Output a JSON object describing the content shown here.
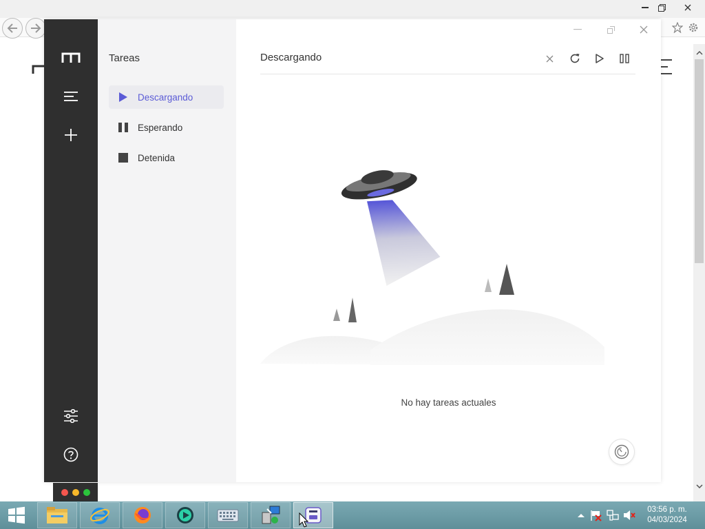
{
  "app": {
    "nav_title": "Tareas",
    "nav_items": [
      {
        "label": "Descargando",
        "icon": "play-icon",
        "active": true
      },
      {
        "label": "Esperando",
        "icon": "pause-icon",
        "active": false
      },
      {
        "label": "Detenida",
        "icon": "stop-icon",
        "active": false
      }
    ],
    "header_title": "Descargando",
    "empty_message": "No hay tareas actuales",
    "accent_color": "#5b5bd6",
    "rail_color": "#2f2f2f"
  },
  "taskbar": {
    "clock_time": "03:56 p. m.",
    "clock_date": "04/03/2024"
  }
}
